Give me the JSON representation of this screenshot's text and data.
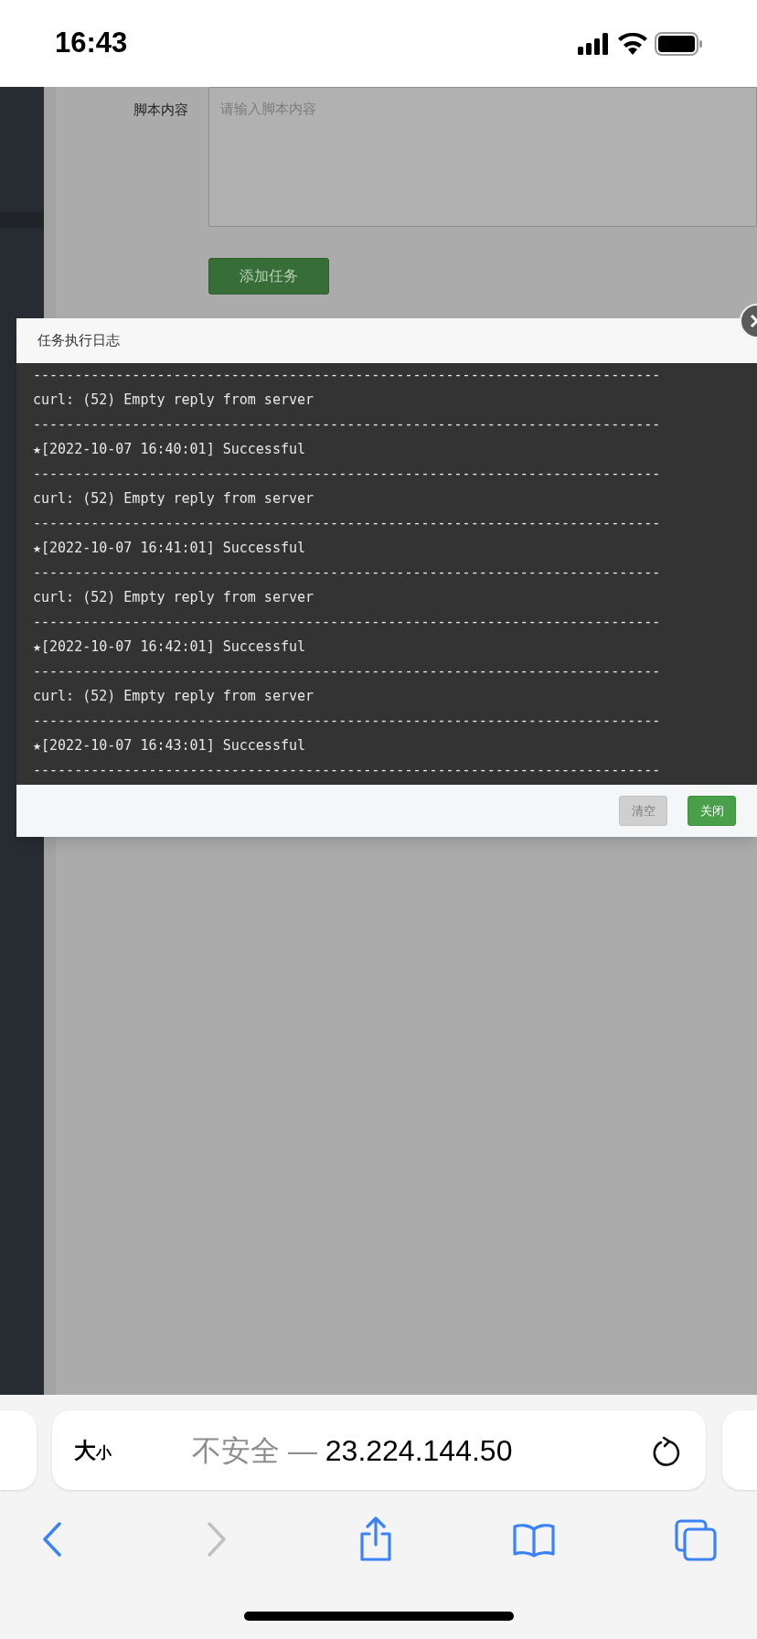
{
  "status_bar": {
    "time": "16:43"
  },
  "form": {
    "label": "脚本内容",
    "textarea": {
      "placeholder": "请输入脚本内容"
    },
    "submit_button": "添加任务"
  },
  "dialog": {
    "title": "任务执行日志",
    "log_lines": [
      "----------------------------------------------------------------------------",
      "curl: (52) Empty reply from server",
      "----------------------------------------------------------------------------",
      "★[2022-10-07 16:40:01] Successful",
      "----------------------------------------------------------------------------",
      "curl: (52) Empty reply from server",
      "----------------------------------------------------------------------------",
      "★[2022-10-07 16:41:01] Successful",
      "----------------------------------------------------------------------------",
      "curl: (52) Empty reply from server",
      "----------------------------------------------------------------------------",
      "★[2022-10-07 16:42:01] Successful",
      "----------------------------------------------------------------------------",
      "curl: (52) Empty reply from server",
      "----------------------------------------------------------------------------",
      "★[2022-10-07 16:43:01] Successful",
      "----------------------------------------------------------------------------"
    ],
    "buttons": [
      {
        "label": "清空",
        "disabled": true
      },
      {
        "label": "关闭",
        "disabled": false
      }
    ]
  },
  "browser": {
    "text_size_button": {
      "large": "大",
      "small": "小"
    },
    "url_prefix": "不安全 —",
    "url": "23.224.144.50"
  }
}
